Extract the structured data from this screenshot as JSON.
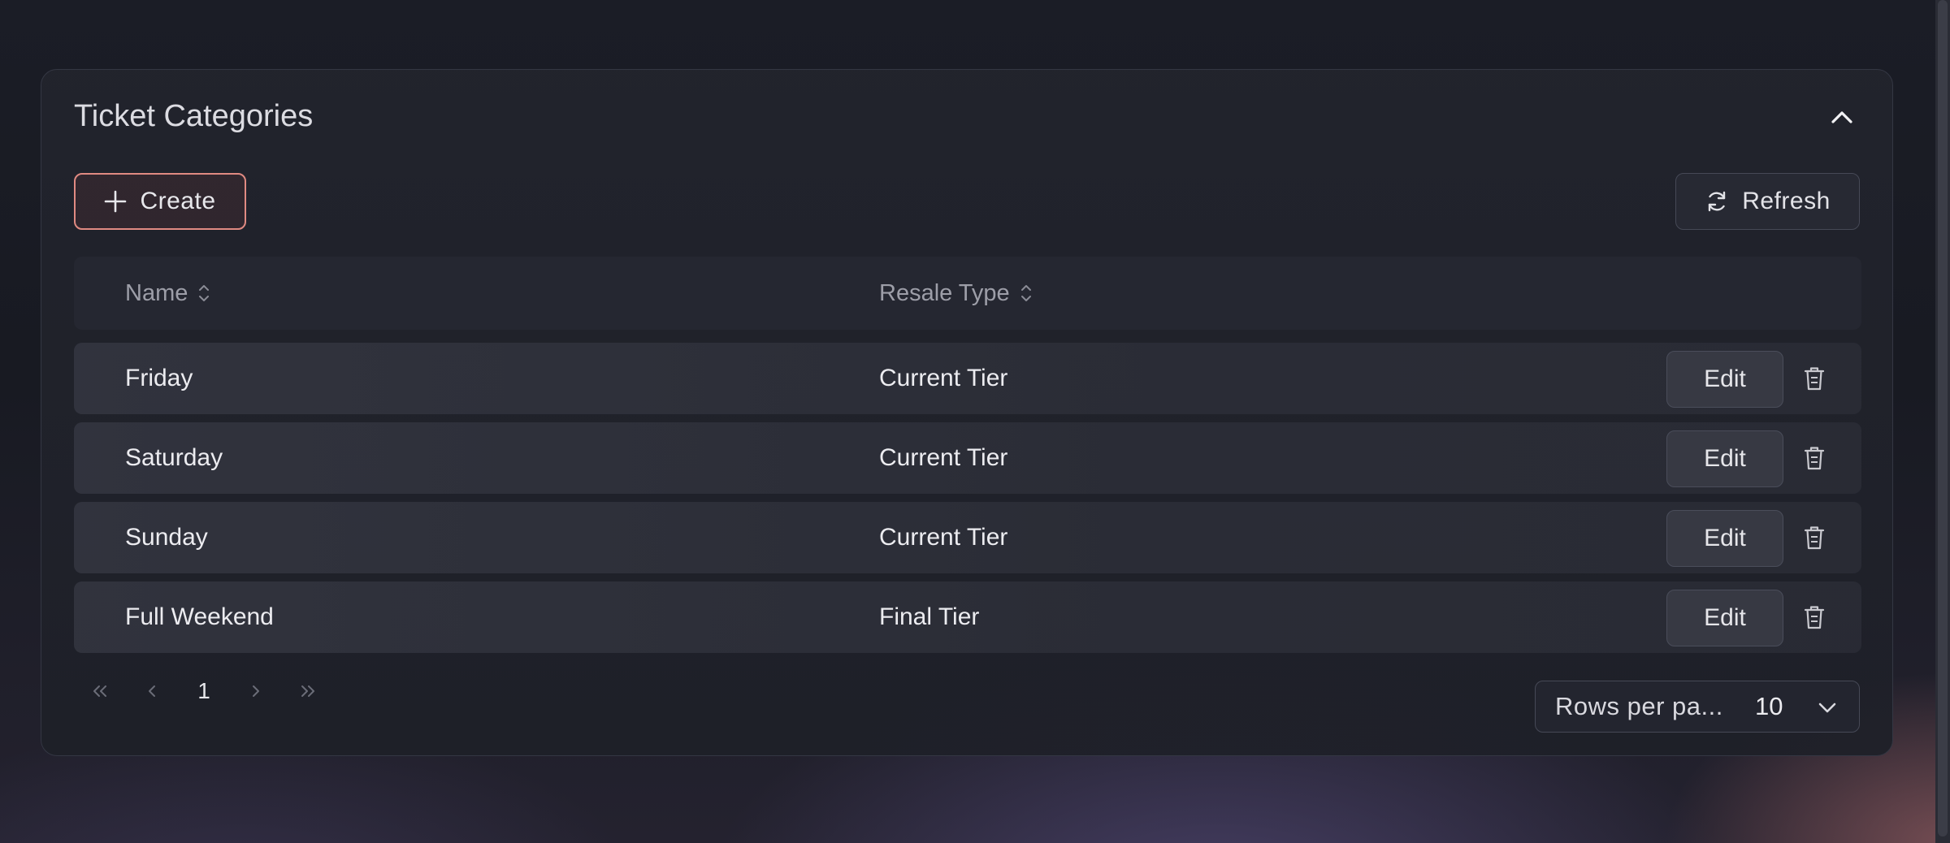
{
  "card": {
    "title": "Ticket Categories"
  },
  "toolbar": {
    "create_label": "Create",
    "refresh_label": "Refresh"
  },
  "table": {
    "columns": [
      {
        "label": "Name",
        "sortable": true
      },
      {
        "label": "Resale Type",
        "sortable": true
      }
    ],
    "rows": [
      {
        "name": "Friday",
        "resale_type": "Current Tier",
        "edit_label": "Edit"
      },
      {
        "name": "Saturday",
        "resale_type": "Current Tier",
        "edit_label": "Edit"
      },
      {
        "name": "Sunday",
        "resale_type": "Current Tier",
        "edit_label": "Edit"
      },
      {
        "name": "Full Weekend",
        "resale_type": "Final Tier",
        "edit_label": "Edit"
      }
    ]
  },
  "pagination": {
    "current_page": "1",
    "rows_per_page_label": "Rows per pa...",
    "rows_per_page_value": "10"
  },
  "icons": {
    "collapse": "chevron-up-icon",
    "create": "plus-icon",
    "refresh": "refresh-icon",
    "sort": "sort-icon",
    "delete": "trash-icon",
    "first": "chevrons-left-icon",
    "prev": "chevron-left-icon",
    "next": "chevron-right-icon",
    "last": "chevrons-right-icon",
    "dropdown": "chevron-down-icon"
  },
  "colors": {
    "accent_border": "#e08a82",
    "background": "#1b1d26"
  }
}
